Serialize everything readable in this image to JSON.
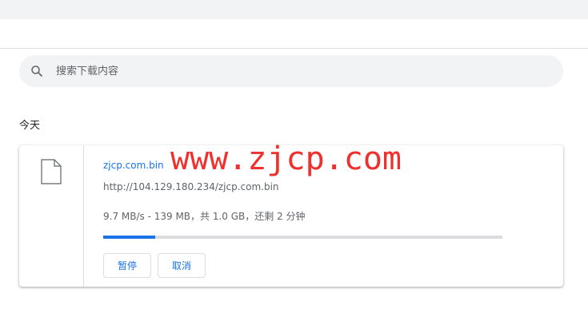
{
  "search": {
    "placeholder": "搜索下载内容",
    "icon": "search-icon"
  },
  "date_header": "今天",
  "download": {
    "file_name": "zjcp.com.bin",
    "url": "http://104.129.180.234/zjcp.com.bin",
    "status": "9.7 MB/s - 139 MB，共 1.0 GB，还剩 2 分钟",
    "progress_fraction": 0.13,
    "file_icon": "file-icon",
    "pause_label": "暂停",
    "cancel_label": "取消"
  },
  "watermark": "www.zjcp.com",
  "colors": {
    "accent": "#1a73e8",
    "watermark": "#f0302c",
    "topbar": "#f1f3f4"
  }
}
